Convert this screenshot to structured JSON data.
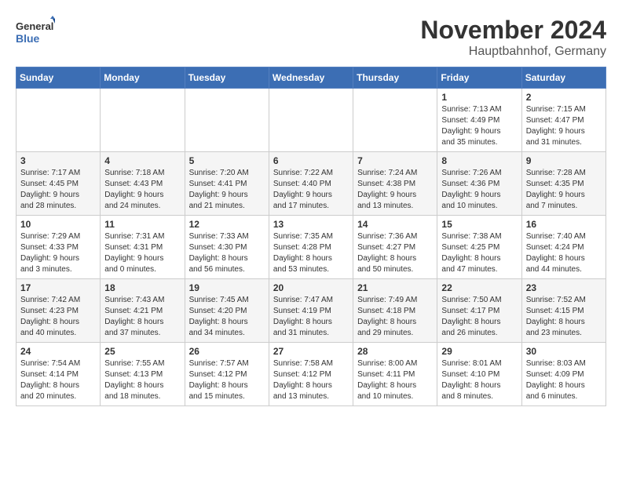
{
  "logo": {
    "line1": "General",
    "line2": "Blue"
  },
  "title": "November 2024",
  "location": "Hauptbahnhof, Germany",
  "weekdays": [
    "Sunday",
    "Monday",
    "Tuesday",
    "Wednesday",
    "Thursday",
    "Friday",
    "Saturday"
  ],
  "weeks": [
    [
      {
        "day": "",
        "info": ""
      },
      {
        "day": "",
        "info": ""
      },
      {
        "day": "",
        "info": ""
      },
      {
        "day": "",
        "info": ""
      },
      {
        "day": "",
        "info": ""
      },
      {
        "day": "1",
        "info": "Sunrise: 7:13 AM\nSunset: 4:49 PM\nDaylight: 9 hours\nand 35 minutes."
      },
      {
        "day": "2",
        "info": "Sunrise: 7:15 AM\nSunset: 4:47 PM\nDaylight: 9 hours\nand 31 minutes."
      }
    ],
    [
      {
        "day": "3",
        "info": "Sunrise: 7:17 AM\nSunset: 4:45 PM\nDaylight: 9 hours\nand 28 minutes."
      },
      {
        "day": "4",
        "info": "Sunrise: 7:18 AM\nSunset: 4:43 PM\nDaylight: 9 hours\nand 24 minutes."
      },
      {
        "day": "5",
        "info": "Sunrise: 7:20 AM\nSunset: 4:41 PM\nDaylight: 9 hours\nand 21 minutes."
      },
      {
        "day": "6",
        "info": "Sunrise: 7:22 AM\nSunset: 4:40 PM\nDaylight: 9 hours\nand 17 minutes."
      },
      {
        "day": "7",
        "info": "Sunrise: 7:24 AM\nSunset: 4:38 PM\nDaylight: 9 hours\nand 13 minutes."
      },
      {
        "day": "8",
        "info": "Sunrise: 7:26 AM\nSunset: 4:36 PM\nDaylight: 9 hours\nand 10 minutes."
      },
      {
        "day": "9",
        "info": "Sunrise: 7:28 AM\nSunset: 4:35 PM\nDaylight: 9 hours\nand 7 minutes."
      }
    ],
    [
      {
        "day": "10",
        "info": "Sunrise: 7:29 AM\nSunset: 4:33 PM\nDaylight: 9 hours\nand 3 minutes."
      },
      {
        "day": "11",
        "info": "Sunrise: 7:31 AM\nSunset: 4:31 PM\nDaylight: 9 hours\nand 0 minutes."
      },
      {
        "day": "12",
        "info": "Sunrise: 7:33 AM\nSunset: 4:30 PM\nDaylight: 8 hours\nand 56 minutes."
      },
      {
        "day": "13",
        "info": "Sunrise: 7:35 AM\nSunset: 4:28 PM\nDaylight: 8 hours\nand 53 minutes."
      },
      {
        "day": "14",
        "info": "Sunrise: 7:36 AM\nSunset: 4:27 PM\nDaylight: 8 hours\nand 50 minutes."
      },
      {
        "day": "15",
        "info": "Sunrise: 7:38 AM\nSunset: 4:25 PM\nDaylight: 8 hours\nand 47 minutes."
      },
      {
        "day": "16",
        "info": "Sunrise: 7:40 AM\nSunset: 4:24 PM\nDaylight: 8 hours\nand 44 minutes."
      }
    ],
    [
      {
        "day": "17",
        "info": "Sunrise: 7:42 AM\nSunset: 4:23 PM\nDaylight: 8 hours\nand 40 minutes."
      },
      {
        "day": "18",
        "info": "Sunrise: 7:43 AM\nSunset: 4:21 PM\nDaylight: 8 hours\nand 37 minutes."
      },
      {
        "day": "19",
        "info": "Sunrise: 7:45 AM\nSunset: 4:20 PM\nDaylight: 8 hours\nand 34 minutes."
      },
      {
        "day": "20",
        "info": "Sunrise: 7:47 AM\nSunset: 4:19 PM\nDaylight: 8 hours\nand 31 minutes."
      },
      {
        "day": "21",
        "info": "Sunrise: 7:49 AM\nSunset: 4:18 PM\nDaylight: 8 hours\nand 29 minutes."
      },
      {
        "day": "22",
        "info": "Sunrise: 7:50 AM\nSunset: 4:17 PM\nDaylight: 8 hours\nand 26 minutes."
      },
      {
        "day": "23",
        "info": "Sunrise: 7:52 AM\nSunset: 4:15 PM\nDaylight: 8 hours\nand 23 minutes."
      }
    ],
    [
      {
        "day": "24",
        "info": "Sunrise: 7:54 AM\nSunset: 4:14 PM\nDaylight: 8 hours\nand 20 minutes."
      },
      {
        "day": "25",
        "info": "Sunrise: 7:55 AM\nSunset: 4:13 PM\nDaylight: 8 hours\nand 18 minutes."
      },
      {
        "day": "26",
        "info": "Sunrise: 7:57 AM\nSunset: 4:12 PM\nDaylight: 8 hours\nand 15 minutes."
      },
      {
        "day": "27",
        "info": "Sunrise: 7:58 AM\nSunset: 4:12 PM\nDaylight: 8 hours\nand 13 minutes."
      },
      {
        "day": "28",
        "info": "Sunrise: 8:00 AM\nSunset: 4:11 PM\nDaylight: 8 hours\nand 10 minutes."
      },
      {
        "day": "29",
        "info": "Sunrise: 8:01 AM\nSunset: 4:10 PM\nDaylight: 8 hours\nand 8 minutes."
      },
      {
        "day": "30",
        "info": "Sunrise: 8:03 AM\nSunset: 4:09 PM\nDaylight: 8 hours\nand 6 minutes."
      }
    ]
  ]
}
